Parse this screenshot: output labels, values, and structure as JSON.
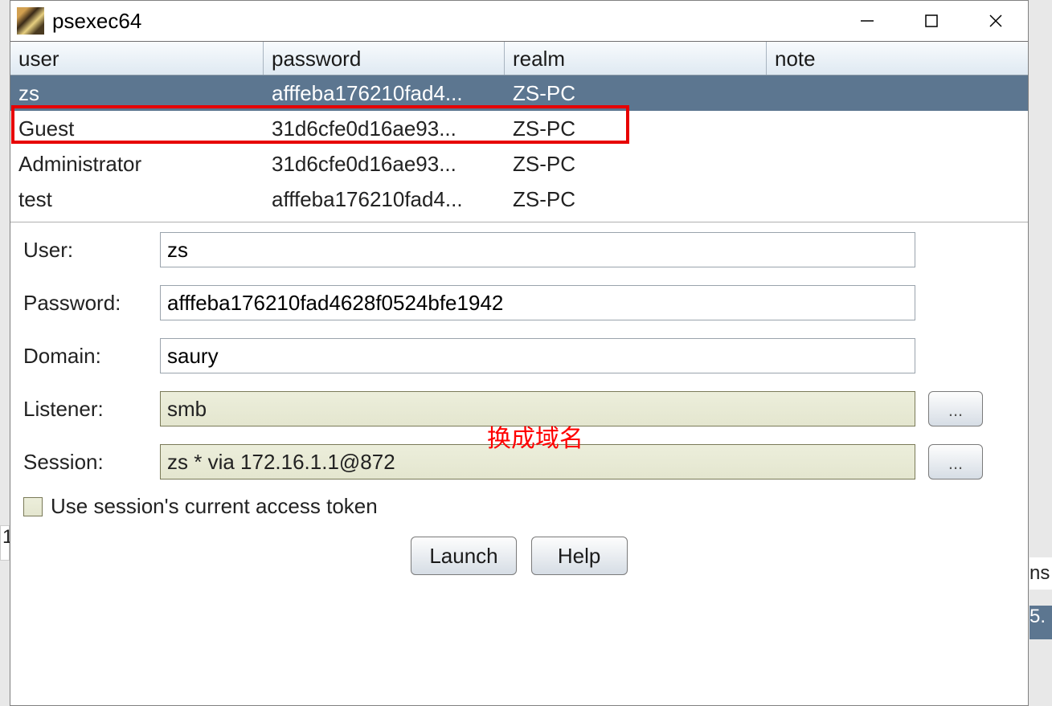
{
  "window": {
    "title": "psexec64"
  },
  "table": {
    "headers": {
      "user": "user",
      "password": "password",
      "realm": "realm",
      "note": "note"
    },
    "rows": [
      {
        "user": "zs",
        "password": "afffeba176210fad4...",
        "realm": "ZS-PC",
        "note": "",
        "selected": true
      },
      {
        "user": "Guest",
        "password": "31d6cfe0d16ae93...",
        "realm": "ZS-PC",
        "note": "",
        "selected": false
      },
      {
        "user": "Administrator",
        "password": "31d6cfe0d16ae93...",
        "realm": "ZS-PC",
        "note": "",
        "selected": false
      },
      {
        "user": "test",
        "password": "afffeba176210fad4...",
        "realm": "ZS-PC",
        "note": "",
        "selected": false
      }
    ]
  },
  "form": {
    "user_label": "User:",
    "user_value": "zs",
    "password_label": "Password:",
    "password_value": "afffeba176210fad4628f0524bfe1942",
    "domain_label": "Domain:",
    "domain_value": "saury",
    "listener_label": "Listener:",
    "listener_value": "smb",
    "session_label": "Session:",
    "session_value": "zs * via  172.16.1.1@872",
    "browse_label": "..."
  },
  "annotation": "换成域名",
  "checkbox": {
    "label": "Use session's current access token",
    "checked": false
  },
  "buttons": {
    "launch": "Launch",
    "help": "Help"
  },
  "background": {
    "left_fragment": "1",
    "right_fragment1": "ns",
    "right_fragment2": "5."
  }
}
